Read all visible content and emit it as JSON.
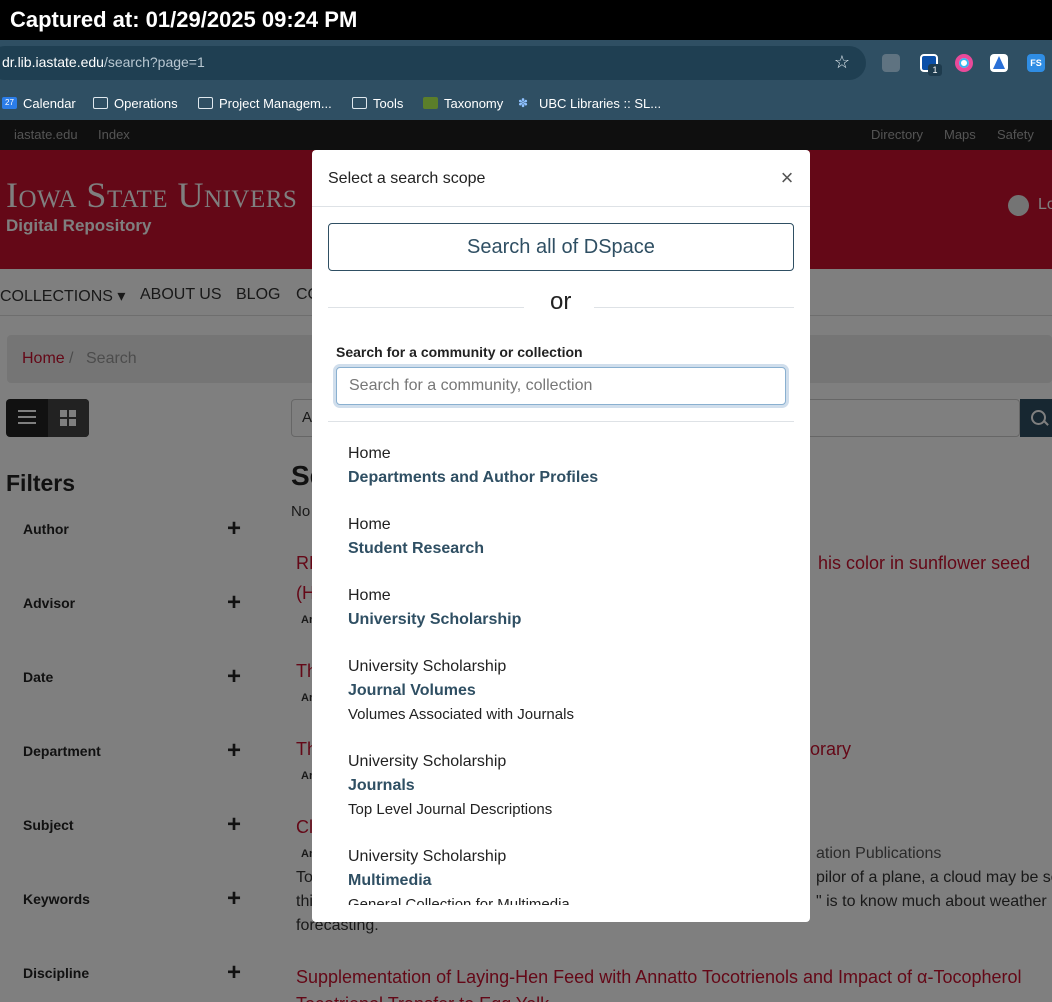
{
  "capture": {
    "text": "Captured at: 01/29/2025 09:24 PM"
  },
  "browser": {
    "url_host": "dr.lib.iastate.edu",
    "url_path": "/search?page=1",
    "ext_badge": "1",
    "ext_fs_label": "FS",
    "bookmarks": [
      {
        "label": "Calendar",
        "icon": "calendar-icon"
      },
      {
        "label": "Operations",
        "icon": "folder-icon"
      },
      {
        "label": "Project Managem...",
        "icon": "folder-icon"
      },
      {
        "label": "Tools",
        "icon": "folder-icon"
      },
      {
        "label": "Taxonomy",
        "icon": "taxonomy-icon"
      },
      {
        "label": "UBC Libraries :: SL...",
        "icon": "ubc-icon"
      }
    ],
    "calendar_icon_text": "27"
  },
  "site": {
    "utility_left": [
      "iastate.edu",
      "Index"
    ],
    "utility_right": [
      "Directory",
      "Maps",
      "Safety"
    ],
    "wordmark": "Iowa State Univers",
    "repository": "Digital Repository",
    "login_fragment": "Lo",
    "nav": [
      "COLLECTIONS ▾",
      "ABOUT US",
      "BLOG",
      "CO"
    ],
    "breadcrumb_home": "Home",
    "breadcrumb_sep": "/",
    "breadcrumb_current": "Search"
  },
  "filters": {
    "title": "Filters",
    "items": [
      "Author",
      "Advisor",
      "Date",
      "Department",
      "Subject",
      "Keywords",
      "Discipline"
    ],
    "plus": "+"
  },
  "background_results": {
    "heading_fragment": "Se",
    "no_fragment": "No",
    "input_fragment": "A",
    "r1_left": "RE",
    "r1_right": "his color in sunflower seed",
    "r1_line2": "(H",
    "r1_meta": "An",
    "r2_left": "Th",
    "r2_meta": "An",
    "r3_left": "Th",
    "r3_right": "orary",
    "r3_meta": "An",
    "r4_left": "Cl",
    "r4_meta": "An",
    "r4_right_meta": "ation Publications",
    "r4_body1_left": "To",
    "r4_body1_right": "pilor of a plane, a cloud may be se",
    "r4_body2_left": "thi",
    "r4_body2_right": "\" is to know much about weather",
    "r4_body3": "forecasting.",
    "r5": "Supplementation of Laying-Hen Feed with Annatto Tocotrienols and Impact of α-Tocopherol",
    "r5_line2": "Tocotrienol Transfer to Egg Yolk"
  },
  "modal": {
    "title": "Select a search scope",
    "close": "×",
    "all_button": "Search all of DSpace",
    "or": "or",
    "field_label": "Search for a community or collection",
    "search_placeholder": "Search for a community, collection",
    "search_value": "",
    "items": [
      {
        "parent": "Home",
        "name": "Departments and Author Profiles",
        "desc": ""
      },
      {
        "parent": "Home",
        "name": "Student Research",
        "desc": ""
      },
      {
        "parent": "Home",
        "name": "University Scholarship",
        "desc": ""
      },
      {
        "parent": "University Scholarship",
        "name": "Journal Volumes",
        "desc": "Volumes Associated with Journals"
      },
      {
        "parent": "University Scholarship",
        "name": "Journals",
        "desc": "Top Level Journal Descriptions"
      },
      {
        "parent": "University Scholarship",
        "name": "Multimedia",
        "desc": "General Collection for Multimedia"
      }
    ]
  },
  "colors": {
    "brand_red": "#c8102e",
    "chrome": "#2f4f63",
    "link_blue": "#2f4f63"
  }
}
